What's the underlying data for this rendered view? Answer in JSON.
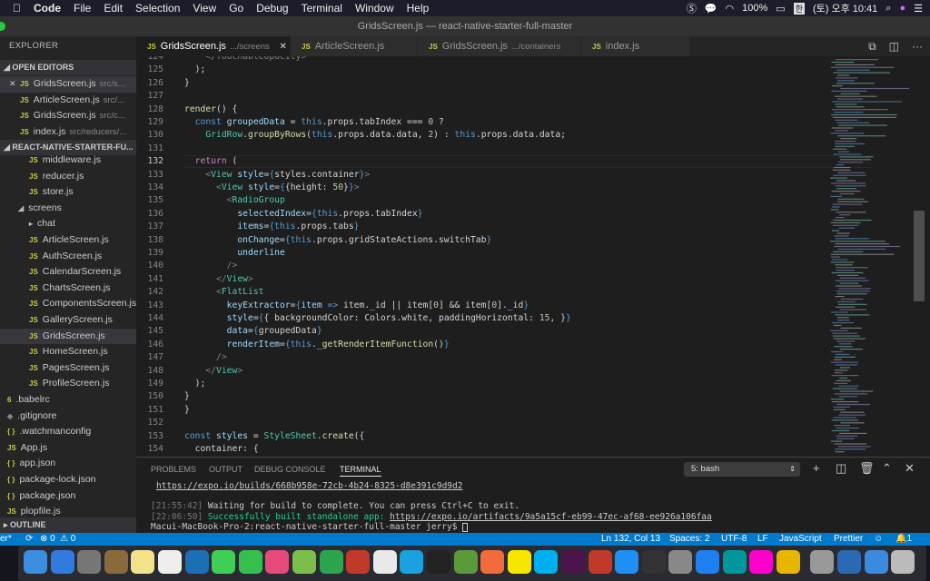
{
  "menubar": {
    "app": "Code",
    "items": [
      "File",
      "Edit",
      "Selection",
      "View",
      "Go",
      "Debug",
      "Terminal",
      "Window",
      "Help"
    ],
    "battery": "100%",
    "ime": "한",
    "clock": "(토) 오후 10:41"
  },
  "window": {
    "title": "GridsScreen.js — react-native-starter-full-master"
  },
  "sidebar": {
    "title": "EXPLORER",
    "open_editors_label": "OPEN EDITORS",
    "open_editors": [
      {
        "name": "GridsScreen.js",
        "path": "src/s...",
        "active": true
      },
      {
        "name": "ArticleScreen.js",
        "path": "src/..."
      },
      {
        "name": "GridsScreen.js",
        "path": "src/c..."
      },
      {
        "name": "index.js",
        "path": "src/reducers/..."
      }
    ],
    "project_label": "REACT-NATIVE-STARTER-FU...",
    "tree": [
      {
        "name": "middleware.js",
        "icon": "js",
        "indent": 2
      },
      {
        "name": "reducer.js",
        "icon": "js",
        "indent": 2
      },
      {
        "name": "store.js",
        "icon": "js",
        "indent": 2
      },
      {
        "name": "screens",
        "icon": "folder-open",
        "indent": 1
      },
      {
        "name": "chat",
        "icon": "folder-closed",
        "indent": 2
      },
      {
        "name": "ArticleScreen.js",
        "icon": "js",
        "indent": 2
      },
      {
        "name": "AuthScreen.js",
        "icon": "js",
        "indent": 2
      },
      {
        "name": "CalendarScreen.js",
        "icon": "js",
        "indent": 2
      },
      {
        "name": "ChartsScreen.js",
        "icon": "js",
        "indent": 2
      },
      {
        "name": "ComponentsScreen.js",
        "icon": "js",
        "indent": 2
      },
      {
        "name": "GalleryScreen.js",
        "icon": "js",
        "indent": 2
      },
      {
        "name": "GridsScreen.js",
        "icon": "js",
        "indent": 2,
        "selected": true
      },
      {
        "name": "HomeScreen.js",
        "icon": "js",
        "indent": 2
      },
      {
        "name": "PagesScreen.js",
        "icon": "js",
        "indent": 2
      },
      {
        "name": "ProfileScreen.js",
        "icon": "js",
        "indent": 2
      },
      {
        "name": ".babelrc",
        "icon": "config",
        "indent": 0
      },
      {
        "name": ".gitignore",
        "icon": "git",
        "indent": 0
      },
      {
        "name": ".watchmanconfig",
        "icon": "json",
        "indent": 0
      },
      {
        "name": "App.js",
        "icon": "js",
        "indent": 0
      },
      {
        "name": "app.json",
        "icon": "json",
        "indent": 0
      },
      {
        "name": "package-lock.json",
        "icon": "json",
        "indent": 0
      },
      {
        "name": "package.json",
        "icon": "json",
        "indent": 0
      },
      {
        "name": "plopfile.js",
        "icon": "js",
        "indent": 0
      }
    ],
    "outline_label": "OUTLINE"
  },
  "tabs": [
    {
      "name": "GridsScreen.js",
      "path": ".../screens",
      "active": true
    },
    {
      "name": "ArticleScreen.js",
      "path": ""
    },
    {
      "name": "GridsScreen.js",
      "path": ".../containers"
    },
    {
      "name": "index.js",
      "path": ""
    }
  ],
  "editor": {
    "first_line": 124,
    "current_line": 132,
    "lines": [
      [
        [
          "g",
          "    </TouchableOpacity>"
        ]
      ],
      [
        [
          "",
          "  );"
        ]
      ],
      [
        [
          "",
          "}"
        ]
      ],
      [],
      [
        [
          "f",
          "render"
        ],
        [
          "",
          "() {"
        ]
      ],
      [
        [
          "k",
          "  const "
        ],
        [
          "a",
          "groupedData"
        ],
        [
          "",
          " = "
        ],
        [
          "k",
          "this"
        ],
        [
          "",
          ".props.tabIndex === "
        ],
        [
          "n",
          "0"
        ],
        [
          "",
          " ?"
        ]
      ],
      [
        [
          "t",
          "    GridRow"
        ],
        [
          "",
          ".",
          ""
        ],
        [
          "f",
          "groupByRows"
        ],
        [
          "",
          "("
        ],
        [
          "k",
          "this"
        ],
        [
          "",
          ".props.data.data, "
        ],
        [
          "n",
          "2"
        ],
        [
          "",
          ") : "
        ],
        [
          "k",
          "this"
        ],
        [
          "",
          ".props.data.data;"
        ]
      ],
      [],
      [
        [
          "c",
          "  return"
        ],
        [
          "",
          " ("
        ]
      ],
      [
        [
          "g",
          "    <"
        ],
        [
          "t",
          "View"
        ],
        [
          "a",
          " style"
        ],
        [
          "",
          "="
        ],
        [
          "k",
          "{"
        ],
        [
          "",
          "styles.container"
        ],
        [
          "k",
          "}"
        ],
        [
          "g",
          ">"
        ]
      ],
      [
        [
          "g",
          "      <"
        ],
        [
          "t",
          "View"
        ],
        [
          "a",
          " style"
        ],
        [
          "",
          "="
        ],
        [
          "k",
          "{"
        ],
        [
          "",
          "{height: "
        ],
        [
          "n",
          "50"
        ],
        [
          "",
          "}"
        ],
        [
          "k",
          "}"
        ],
        [
          "g",
          ">"
        ]
      ],
      [
        [
          "g",
          "        <"
        ],
        [
          "t",
          "RadioGroup"
        ]
      ],
      [
        [
          "a",
          "          selectedIndex"
        ],
        [
          "",
          "="
        ],
        [
          "k",
          "{this"
        ],
        [
          "",
          ".props.tabIndex"
        ],
        [
          "k",
          "}"
        ]
      ],
      [
        [
          "a",
          "          items"
        ],
        [
          "",
          "="
        ],
        [
          "k",
          "{this"
        ],
        [
          "",
          ".props.tabs"
        ],
        [
          "k",
          "}"
        ]
      ],
      [
        [
          "a",
          "          onChange"
        ],
        [
          "",
          "="
        ],
        [
          "k",
          "{this"
        ],
        [
          "",
          ".props.gridStateActions.switchTab"
        ],
        [
          "k",
          "}"
        ]
      ],
      [
        [
          "a",
          "          underline"
        ]
      ],
      [
        [
          "g",
          "        />"
        ]
      ],
      [
        [
          "g",
          "      </"
        ],
        [
          "t",
          "View"
        ],
        [
          "g",
          ">"
        ]
      ],
      [
        [
          "g",
          "      <"
        ],
        [
          "t",
          "FlatList"
        ]
      ],
      [
        [
          "a",
          "        keyExtractor"
        ],
        [
          "",
          "="
        ],
        [
          "k",
          "{"
        ],
        [
          "a",
          "item"
        ],
        [
          "k",
          " =>"
        ],
        [
          "",
          " item._id || item["
        ],
        [
          "n",
          "0"
        ],
        [
          "",
          "] && item["
        ],
        [
          "n",
          "0"
        ],
        [
          "",
          "]._id"
        ],
        [
          "k",
          "}"
        ]
      ],
      [
        [
          "a",
          "        style"
        ],
        [
          "",
          "="
        ],
        [
          "k",
          "{"
        ],
        [
          "",
          "{ backgroundColor: Colors.white, paddingHorizontal: "
        ],
        [
          "n",
          "15"
        ],
        [
          "",
          ", }"
        ],
        [
          "k",
          "}"
        ]
      ],
      [
        [
          "a",
          "        data"
        ],
        [
          "",
          "="
        ],
        [
          "k",
          "{"
        ],
        [
          "",
          "groupedData"
        ],
        [
          "k",
          "}"
        ]
      ],
      [
        [
          "a",
          "        renderItem"
        ],
        [
          "",
          "="
        ],
        [
          "k",
          "{this"
        ],
        [
          "",
          "."
        ],
        [
          "f",
          "_getRenderItemFunction"
        ],
        [
          "",
          "()"
        ],
        [
          "k",
          "}"
        ]
      ],
      [
        [
          "g",
          "      />"
        ]
      ],
      [
        [
          "g",
          "    </"
        ],
        [
          "t",
          "View"
        ],
        [
          "g",
          ">"
        ]
      ],
      [
        [
          "",
          "  );"
        ]
      ],
      [
        [
          "",
          "}"
        ]
      ],
      [
        [
          "",
          "}"
        ]
      ],
      [],
      [
        [
          "k",
          "const "
        ],
        [
          "a",
          "styles"
        ],
        [
          "",
          " = "
        ],
        [
          "t",
          "StyleSheet"
        ],
        [
          "",
          "."
        ],
        [
          "f",
          "create"
        ],
        [
          "",
          "({"
        ]
      ],
      [
        [
          "",
          "  container: {"
        ]
      ]
    ]
  },
  "panel": {
    "tabs": [
      "PROBLEMS",
      "OUTPUT",
      "DEBUG CONSOLE",
      "TERMINAL"
    ],
    "active_tab": "TERMINAL",
    "shell": "5: bash",
    "terminal": {
      "build_url": "https://expo.io/builds/668b958e-72cb-4b24-8325-d8e391c9d9d2",
      "wait_ts": "[21:55:42]",
      "wait_msg": " Waiting for build to complete. You can press Ctrl+C to exit.",
      "done_ts": "[22:06:50]",
      "done_msg": " Successfully built standalone app: ",
      "artifact_url": "https://expo.io/artifacts/9a5a15cf-eb99-47ec-af68-ee926a106faa",
      "prompt": "Macui-MacBook-Pro-2:react-native-starter-full-master jerry$ "
    }
  },
  "statusbar": {
    "branch": "er*",
    "errors": "0",
    "warnings": "0",
    "position": "Ln 132, Col 13",
    "spaces": "Spaces: 2",
    "encoding": "UTF-8",
    "eol": "LF",
    "language": "JavaScript",
    "formatter": "Prettier",
    "notifications": "1",
    "color": "#007acc"
  },
  "dock": {
    "apps": [
      "Finder",
      "Safari",
      "Launchpad",
      "Contacts",
      "Notes",
      "Reminders",
      "VS Code",
      "Messages",
      "FaceTime",
      "iTunes",
      "Android Studio",
      "Git",
      "FileZilla",
      "Chrome",
      "Skype Web",
      "Terminal",
      "Android Emulator",
      "Postman",
      "KakaoTalk",
      "Skype",
      "Slack",
      "FileZilla",
      "Xcode",
      "GitHub",
      "Preview",
      "App Store",
      "Arduino",
      "Photos",
      "Chrome Canary",
      "System Preferences",
      "Network",
      "Downloads",
      "Trash"
    ]
  }
}
